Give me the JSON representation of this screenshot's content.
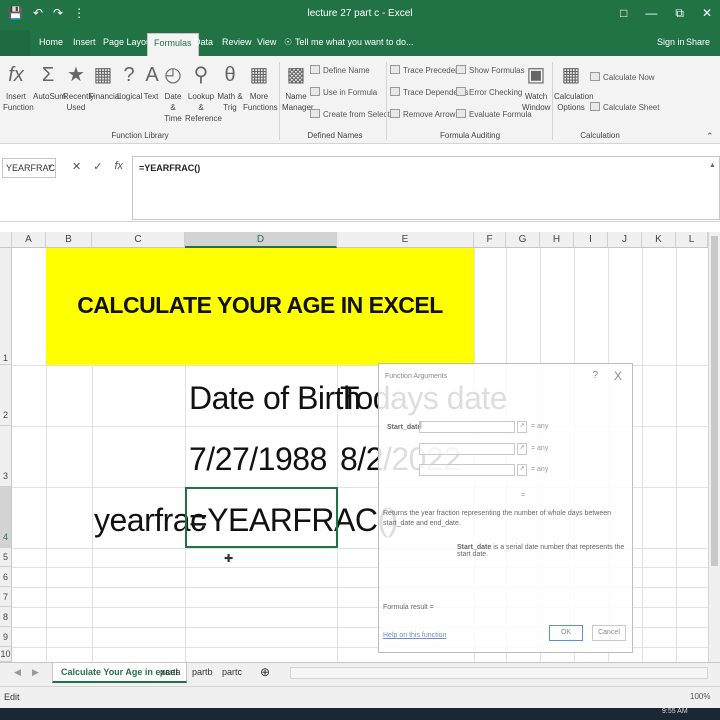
{
  "window": {
    "title": "lecture 27 part c - Excel",
    "qat": [
      "save-icon",
      "undo-icon",
      "redo-icon",
      "customize-icon"
    ]
  },
  "tabs": {
    "home": "Home",
    "insert": "Insert",
    "page_layout": "Page Layout",
    "formulas": "Formulas",
    "data": "Data",
    "review": "Review",
    "view": "View",
    "tell_me": "Tell me what you want to do...",
    "sign_in": "Sign in",
    "share": "Share"
  },
  "ribbon": {
    "insert_function": "Insert\nFunction",
    "autosum": "AutoSum",
    "recently_used": "Recently\nUsed",
    "financial": "Financial",
    "logical": "Logical",
    "text": "Text",
    "date_time": "Date &\nTime",
    "lookup_reference": "Lookup &\nReference",
    "math_trig": "Math &\nTrig",
    "more_functions": "More\nFunctions",
    "name_manager": "Name\nManager",
    "define_name": "Define Name",
    "use_in_formula": "Use in Formula",
    "create_from_selection": "Create from Selection",
    "trace_precedents": "Trace Precedents",
    "trace_dependents": "Trace Dependents",
    "remove_arrows": "Remove Arrows",
    "show_formulas": "Show Formulas",
    "error_checking": "Error Checking",
    "evaluate_formula": "Evaluate Formula",
    "watch_window": "Watch\nWindow",
    "calculation_options": "Calculation\nOptions",
    "calculate_now": "Calculate Now",
    "calculate_sheet": "Calculate Sheet",
    "groups": {
      "function_library": "Function Library",
      "defined_names": "Defined Names",
      "formula_auditing": "Formula Auditing",
      "calculation": "Calculation"
    }
  },
  "formula_bar": {
    "name_box": "YEARFRAC",
    "formula": "=YEARFRAC()"
  },
  "columns": [
    "A",
    "B",
    "C",
    "D",
    "E",
    "F",
    "G",
    "H",
    "I",
    "J",
    "K",
    "L"
  ],
  "rows": [
    "1",
    "2",
    "3",
    "4",
    "5",
    "6",
    "7",
    "8",
    "9",
    "10"
  ],
  "cells": {
    "title": "CALCULATE YOUR AGE IN EXCEL",
    "d2": "Date of Birth",
    "e2": "Todays date",
    "d3": "7/27/1988",
    "e3": "8/2/2022",
    "c4": "yearfrac",
    "d4": "=YEARFRAC()"
  },
  "dialog": {
    "title": "Function Arguments",
    "help_q": "?",
    "close": "X",
    "start_date_label": "Start_date",
    "start_date_value": "|",
    "eq_any": "= any",
    "eq": "=",
    "description": "Returns the year fraction representing the number of whole days between start_date and end_date.",
    "arg_name": "Start_date",
    "arg_desc": "is a serial date number that represents the start date.",
    "formula_result": "Formula result =",
    "help_link": "Help on this function",
    "ok": "OK",
    "cancel": "Cancel"
  },
  "sheets": [
    "Calculate Your Age in excel",
    "parta",
    "partb",
    "partc"
  ],
  "status": {
    "mode": "Edit",
    "zoom": "100%"
  },
  "taskbar": {
    "time": "9:55 AM"
  }
}
